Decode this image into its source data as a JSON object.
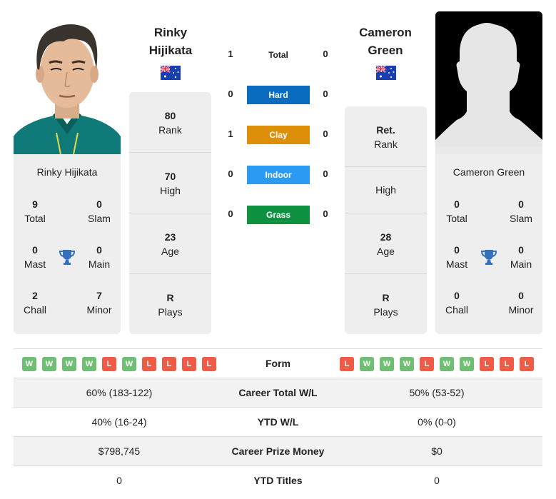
{
  "colors": {
    "hard": "#0a6cbf",
    "clay": "#de8f0a",
    "indoor": "#2b9af3",
    "grass": "#0e9140",
    "win": "#6fbf73",
    "loss": "#ef5b45",
    "trophy": "#3470bd",
    "panel": "#eeeeee"
  },
  "player1": {
    "name_line1": "Rinky",
    "name_line2": "Hijikata",
    "full_name": "Rinky Hijikata",
    "country_flag": "australia-flag",
    "photo": "player-photo",
    "rank": {
      "value": "80",
      "label": "Rank"
    },
    "high": {
      "value": "70",
      "label": "High"
    },
    "age": {
      "value": "23",
      "label": "Age"
    },
    "plays": {
      "value": "R",
      "label": "Plays"
    },
    "titles": {
      "total": {
        "value": "9",
        "label": "Total"
      },
      "slam": {
        "value": "0",
        "label": "Slam"
      },
      "mast": {
        "value": "0",
        "label": "Mast"
      },
      "main": {
        "value": "0",
        "label": "Main"
      },
      "chall": {
        "value": "2",
        "label": "Chall"
      },
      "minor": {
        "value": "7",
        "label": "Minor"
      }
    },
    "form": [
      "W",
      "W",
      "W",
      "W",
      "L",
      "W",
      "L",
      "L",
      "L",
      "L"
    ]
  },
  "player2": {
    "name_line1": "Cameron",
    "name_line2": "Green",
    "full_name": "Cameron Green",
    "country_flag": "australia-flag",
    "photo": "silhouette-placeholder",
    "rank": {
      "value": "Ret.",
      "label": "Rank"
    },
    "high": {
      "value": "",
      "label": "High"
    },
    "age": {
      "value": "28",
      "label": "Age"
    },
    "plays": {
      "value": "R",
      "label": "Plays"
    },
    "titles": {
      "total": {
        "value": "0",
        "label": "Total"
      },
      "slam": {
        "value": "0",
        "label": "Slam"
      },
      "mast": {
        "value": "0",
        "label": "Mast"
      },
      "main": {
        "value": "0",
        "label": "Main"
      },
      "chall": {
        "value": "0",
        "label": "Chall"
      },
      "minor": {
        "value": "0",
        "label": "Minor"
      }
    },
    "form": [
      "L",
      "W",
      "W",
      "W",
      "L",
      "W",
      "W",
      "L",
      "L",
      "L"
    ]
  },
  "h2h": [
    {
      "label": "Total",
      "p1": "1",
      "p2": "0",
      "surface": "total"
    },
    {
      "label": "Hard",
      "p1": "0",
      "p2": "0",
      "surface": "hard"
    },
    {
      "label": "Clay",
      "p1": "1",
      "p2": "0",
      "surface": "clay"
    },
    {
      "label": "Indoor",
      "p1": "0",
      "p2": "0",
      "surface": "indoor"
    },
    {
      "label": "Grass",
      "p1": "0",
      "p2": "0",
      "surface": "grass"
    }
  ],
  "table": {
    "form_label": "Form",
    "rows": [
      {
        "label": "Career Total W/L",
        "p1": "60% (183-122)",
        "p2": "50% (53-52)"
      },
      {
        "label": "YTD W/L",
        "p1": "40% (16-24)",
        "p2": "0% (0-0)"
      },
      {
        "label": "Career Prize Money",
        "p1": "$798,745",
        "p2": "$0"
      },
      {
        "label": "YTD Titles",
        "p1": "0",
        "p2": "0"
      }
    ]
  }
}
